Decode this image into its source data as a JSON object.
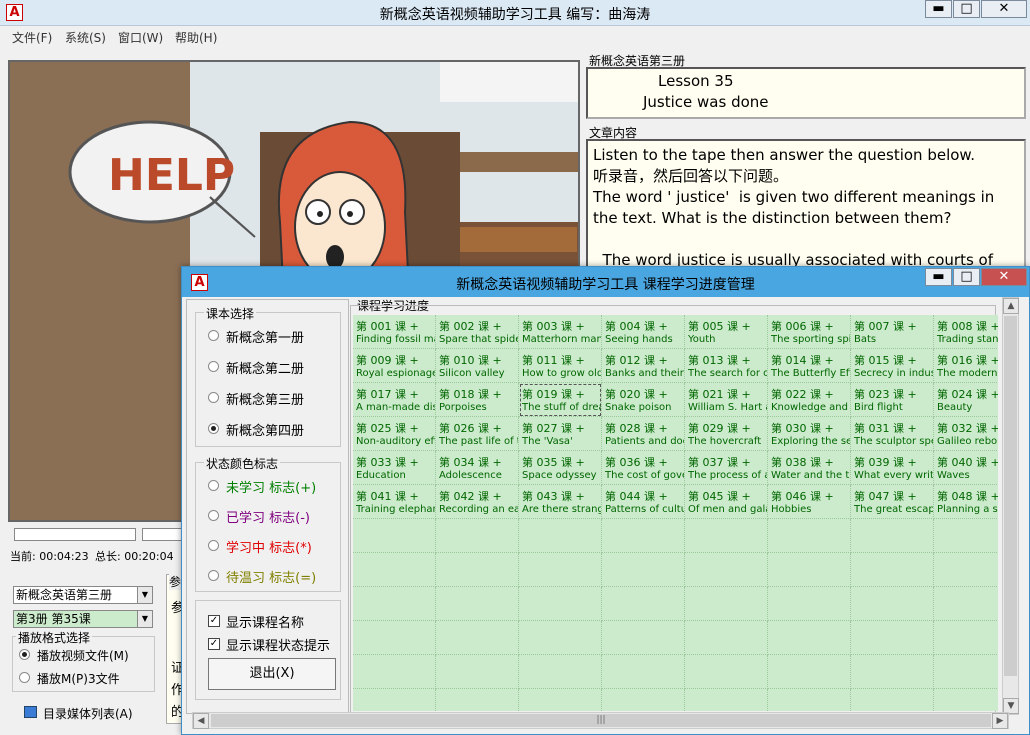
{
  "window": {
    "title": "新概念英语视频辅助学习工具    编写：曲海涛",
    "icon_letter": "A"
  },
  "menu": [
    "文件(F)",
    "系统(S)",
    "窗口(W)",
    "帮助(H)"
  ],
  "book_panel": {
    "label": "新概念英语第三册",
    "lesson": "Lesson 35",
    "lesson_title": "Justice was done"
  },
  "article": {
    "label": "文章内容",
    "text": "Listen to the tape then answer the question below.\n听录音，然后回答以下问题。\nThe word ' justice'  is given two different meanings in the text. What is the distinction between them?\n\n  The word justice is usually associated with courts of"
  },
  "player": {
    "current": "当前: 00:04:23",
    "total": "总长: 00:20:04"
  },
  "left_controls": {
    "book_select": "新概念英语第三册",
    "lesson_select": "第3册 第35课",
    "play_format_label": "播放格式选择",
    "play_video": "播放视频文件(M)",
    "play_mp3": "播放M(P)3文件",
    "media_list": "目录媒体列表(A)",
    "partial_label": "参",
    "partial_lines": [
      "参",
      "证",
      "作",
      "的"
    ]
  },
  "dialog": {
    "title": "新概念英语视频辅助学习工具    课程学习进度管理",
    "book_group_label": "课本选择",
    "books": [
      {
        "label": "新概念第一册",
        "checked": false
      },
      {
        "label": "新概念第二册",
        "checked": false
      },
      {
        "label": "新概念第三册",
        "checked": false
      },
      {
        "label": "新概念第四册",
        "checked": true
      }
    ],
    "status_group_label": "状态颜色标志",
    "statuses": [
      {
        "label": "未学习 标志(+)",
        "color": "#008000"
      },
      {
        "label": "已学习 标志(-)",
        "color": "#800080"
      },
      {
        "label": "学习中 标志(*)",
        "color": "#e00000"
      },
      {
        "label": "待温习 标志(=)",
        "color": "#808000"
      }
    ],
    "show_name": "显示课程名称",
    "show_status": "显示课程状态提示",
    "exit_button": "退出(X)",
    "progress_label": "课程学习进度",
    "lessons": [
      {
        "num": "第 001 课 +",
        "name": "Finding fossil man"
      },
      {
        "num": "第 002 课 +",
        "name": "Spare that spider"
      },
      {
        "num": "第 003 课 +",
        "name": "Matterhorn man"
      },
      {
        "num": "第 004 课 +",
        "name": "Seeing hands"
      },
      {
        "num": "第 005 课 +",
        "name": "Youth"
      },
      {
        "num": "第 006 课 +",
        "name": "The sporting spirit"
      },
      {
        "num": "第 007 课 +",
        "name": "Bats"
      },
      {
        "num": "第 008 课 +",
        "name": "Trading standards"
      },
      {
        "num": "第 009 课 +",
        "name": "Royal espionage"
      },
      {
        "num": "第 010 课 +",
        "name": "Silicon valley"
      },
      {
        "num": "第 011 课 +",
        "name": "How to grow old"
      },
      {
        "num": "第 012 课 +",
        "name": "Banks and their customers"
      },
      {
        "num": "第 013 课 +",
        "name": "The search for oil"
      },
      {
        "num": "第 014 课 +",
        "name": "The Butterfly Effect"
      },
      {
        "num": "第 015 课 +",
        "name": "Secrecy in industry"
      },
      {
        "num": "第 016 课 +",
        "name": "The modern city"
      },
      {
        "num": "第 017 课 +",
        "name": "A man-made disease"
      },
      {
        "num": "第 018 课 +",
        "name": "Porpoises"
      },
      {
        "num": "第 019 课 +",
        "name": "The stuff of dreams"
      },
      {
        "num": "第 020 课 +",
        "name": "Snake poison"
      },
      {
        "num": "第 021 课 +",
        "name": "William S. Hart and"
      },
      {
        "num": "第 022 课 +",
        "name": "Knowledge and progress"
      },
      {
        "num": "第 023 课 +",
        "name": "Bird flight"
      },
      {
        "num": "第 024 课 +",
        "name": "Beauty"
      },
      {
        "num": "第 025 课 +",
        "name": "Non-auditory effects"
      },
      {
        "num": "第 026 课 +",
        "name": "The past life of the"
      },
      {
        "num": "第 027 课 +",
        "name": "The 'Vasa'"
      },
      {
        "num": "第 028 课 +",
        "name": "Patients and doctors"
      },
      {
        "num": "第 029 课 +",
        "name": "The hovercraft"
      },
      {
        "num": "第 030 课 +",
        "name": "Exploring the sea"
      },
      {
        "num": "第 031 课 +",
        "name": "The sculptor speaks"
      },
      {
        "num": "第 032 课 +",
        "name": "Galileo reborn"
      },
      {
        "num": "第 033 课 +",
        "name": "Education"
      },
      {
        "num": "第 034 课 +",
        "name": "Adolescence"
      },
      {
        "num": "第 035 课 +",
        "name": "Space odyssey"
      },
      {
        "num": "第 036 课 +",
        "name": "The cost of government"
      },
      {
        "num": "第 037 课 +",
        "name": "The process of ageing"
      },
      {
        "num": "第 038 课 +",
        "name": "Water and the traveller"
      },
      {
        "num": "第 039 课 +",
        "name": "What every writer wants"
      },
      {
        "num": "第 040 课 +",
        "name": "Waves"
      },
      {
        "num": "第 041 课 +",
        "name": "Training elephants"
      },
      {
        "num": "第 042 课 +",
        "name": "Recording an earthquake"
      },
      {
        "num": "第 043 课 +",
        "name": "Are there strangers"
      },
      {
        "num": "第 044 课 +",
        "name": "Patterns of culture"
      },
      {
        "num": "第 045 课 +",
        "name": "Of men and galaxies"
      },
      {
        "num": "第 046 课 +",
        "name": "Hobbies"
      },
      {
        "num": "第 047 课 +",
        "name": "The great escape"
      },
      {
        "num": "第 048 课 +",
        "name": "Planning a share"
      }
    ]
  },
  "video": {
    "help_text": "HELP"
  }
}
